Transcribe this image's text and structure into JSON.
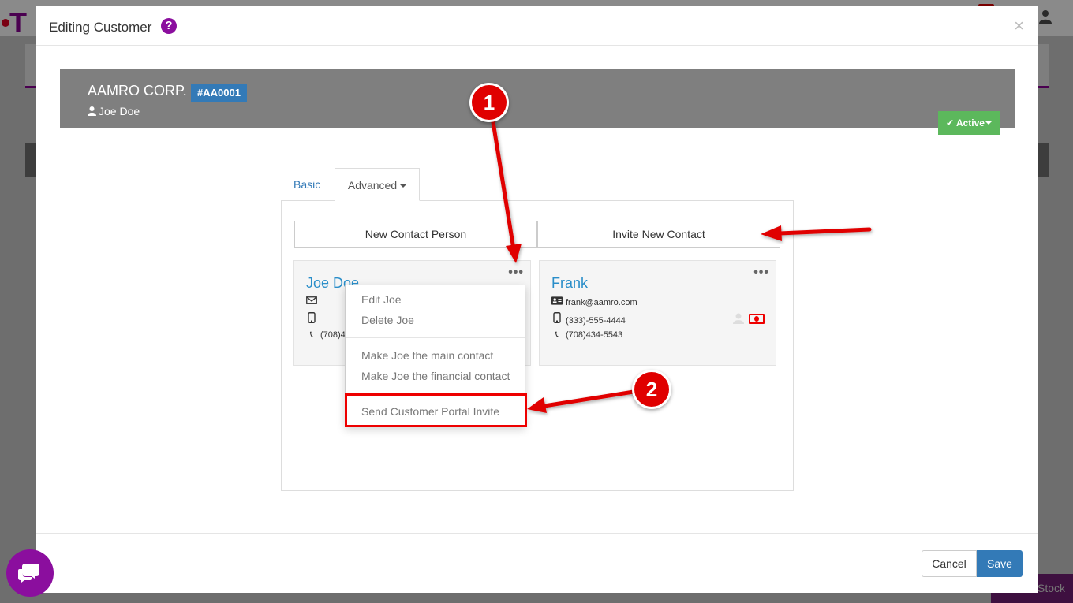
{
  "modal": {
    "title": "Editing Customer",
    "help_glyph": "?",
    "close_glyph": "×"
  },
  "customer": {
    "name": "AAMRO CORP.",
    "code": "#AA0001",
    "primary_contact": "Joe Doe",
    "status_label": "Active"
  },
  "tabs": [
    {
      "label": "Basic"
    },
    {
      "label": "Advanced"
    }
  ],
  "actions": {
    "new_contact": "New Contact Person",
    "invite_contact": "Invite New Contact"
  },
  "contacts": [
    {
      "name": "Joe Doe",
      "phone": "(708)4",
      "menu_glyph": "•••"
    },
    {
      "name": "Frank",
      "email": "frank@aamro.com",
      "mobile": "(333)-555-4444",
      "phone": "(708)434-5543",
      "menu_glyph": "•••"
    }
  ],
  "contact_menu": {
    "items": [
      "Edit Joe",
      "Delete Joe",
      "Make Joe the main contact",
      "Make Joe the financial contact",
      "Send Customer Portal Invite"
    ]
  },
  "footer": {
    "cancel": "Cancel",
    "save": "Save"
  },
  "background": {
    "stock_label": "Stock"
  },
  "annotations": {
    "step1": "1",
    "step2": "2",
    "highlight_color": "#e00000"
  },
  "colors": {
    "brand_purple": "#8b0e9e",
    "primary_blue": "#337ab7",
    "success_green": "#5cb85c",
    "link_blue": "#2a8ec9"
  }
}
